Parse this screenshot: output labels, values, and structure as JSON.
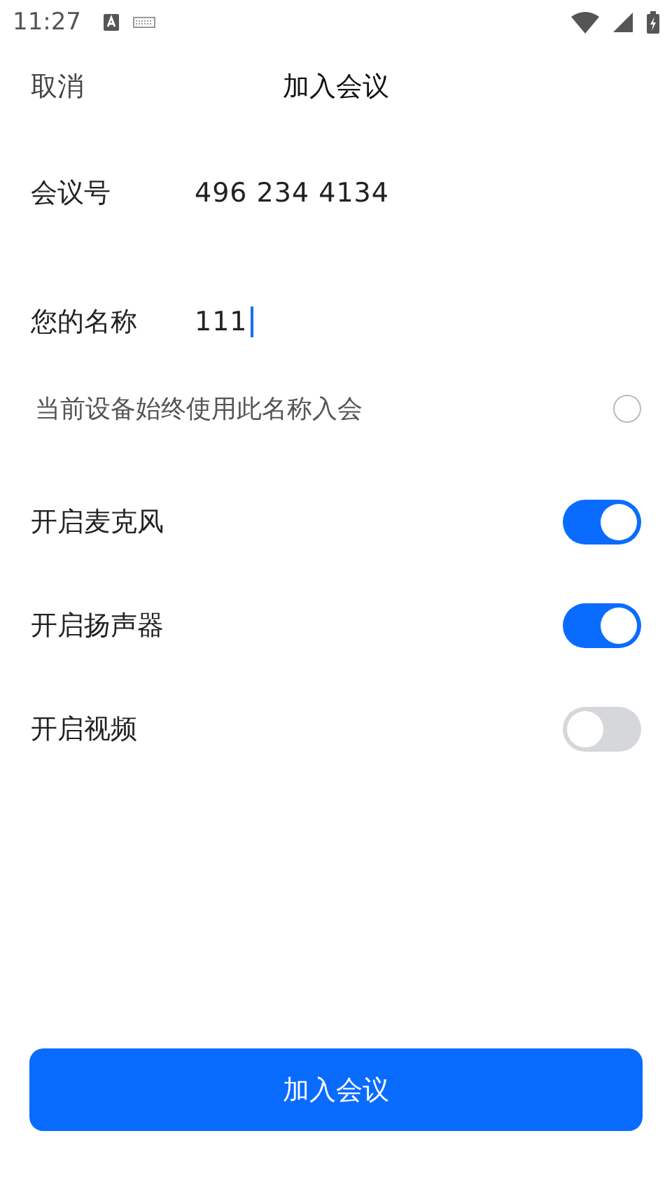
{
  "status_bar": {
    "time": "11:27"
  },
  "header": {
    "cancel": "取消",
    "title": "加入会议"
  },
  "fields": [
    {
      "label": "会议号",
      "value": "496 234 4134",
      "focused": false
    },
    {
      "label": "您的名称",
      "value": "111",
      "focused": true
    }
  ],
  "remember_name": {
    "label": "当前设备始终使用此名称入会",
    "checked": false
  },
  "toggles": [
    {
      "label": "开启麦克风",
      "on": true
    },
    {
      "label": "开启扬声器",
      "on": true
    },
    {
      "label": "开启视频",
      "on": false
    }
  ],
  "join_button": "加入会议"
}
